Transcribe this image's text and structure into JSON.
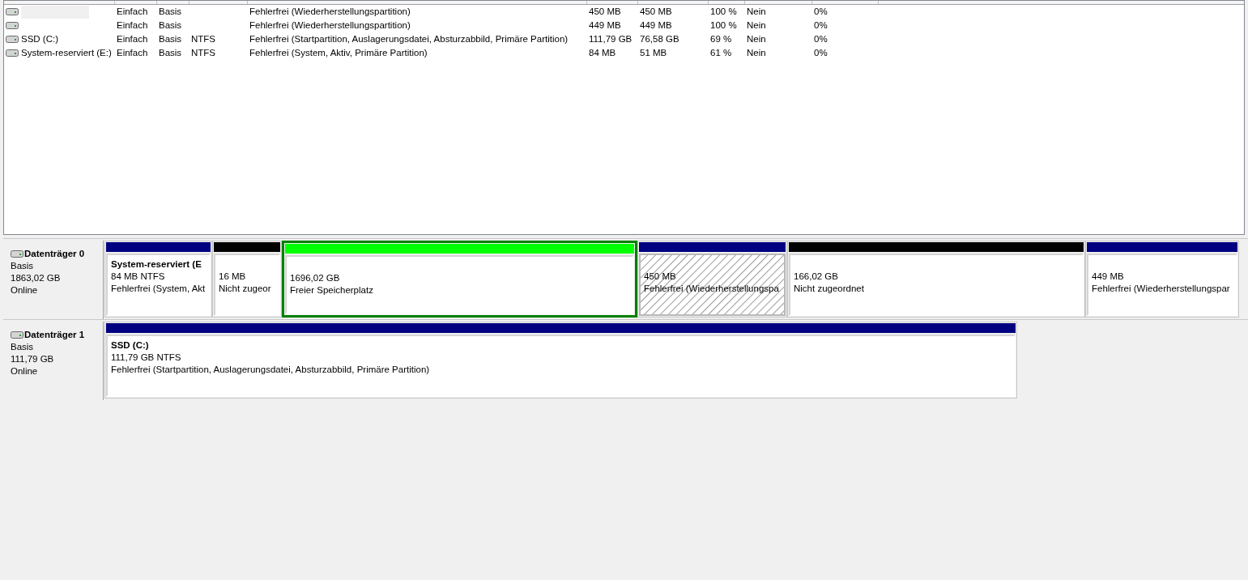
{
  "volumes": [
    {
      "redacted": true,
      "layout": "Einfach",
      "type": "Basis",
      "status": "Fehlerfrei (Wiederherstellungspartition)",
      "capacity": "450 MB",
      "free": "450 MB",
      "free_pct": "100 %",
      "fault_tolerance": "Nein",
      "overhead": "0%"
    },
    {
      "redacted": false,
      "layout": "Einfach",
      "type": "Basis",
      "status": "Fehlerfrei (Wiederherstellungspartition)",
      "capacity": "449 MB",
      "free": "449 MB",
      "free_pct": "100 %",
      "fault_tolerance": "Nein",
      "overhead": "0%"
    },
    {
      "redacted": false,
      "name": "SSD (C:)",
      "layout": "Einfach",
      "type": "Basis",
      "filesystem": "NTFS",
      "status": "Fehlerfrei (Startpartition, Auslagerungsdatei, Absturzabbild, Primäre Partition)",
      "capacity": "111,79 GB",
      "free": "76,58 GB",
      "free_pct": "69 %",
      "fault_tolerance": "Nein",
      "overhead": "0%"
    },
    {
      "redacted": false,
      "name": "System-reserviert (E:)",
      "layout": "Einfach",
      "type": "Basis",
      "filesystem": "NTFS",
      "status": "Fehlerfrei (System, Aktiv, Primäre Partition)",
      "capacity": "84 MB",
      "free": "51 MB",
      "free_pct": "61 %",
      "fault_tolerance": "Nein",
      "overhead": "0%"
    }
  ],
  "disks": [
    {
      "name": "Datenträger 0",
      "type": "Basis",
      "size": "1863,02 GB",
      "state": "Online",
      "partitions": [
        {
          "kind": "primary",
          "color": "#000080",
          "selected": false,
          "title": "System-reserviert  (E",
          "size": "84 MB NTFS",
          "status": "Fehlerfrei (System, Akt"
        },
        {
          "kind": "unallocated",
          "color": "#000000",
          "selected": false,
          "size": "16 MB",
          "status": "Nicht zugeor"
        },
        {
          "kind": "free",
          "color": "#00ff00",
          "selected": false,
          "size": "1696,02 GB",
          "status": "Freier Speicherplatz"
        },
        {
          "kind": "primary",
          "color": "#000080",
          "selected": true,
          "size": "450 MB",
          "status": "Fehlerfrei (Wiederherstellungspa"
        },
        {
          "kind": "unallocated",
          "color": "#000000",
          "selected": false,
          "size": "166,02 GB",
          "status": "Nicht zugeordnet"
        },
        {
          "kind": "primary",
          "color": "#000080",
          "selected": false,
          "size": "449 MB",
          "status": "Fehlerfrei (Wiederherstellungspar"
        }
      ]
    },
    {
      "name": "Datenträger 1",
      "type": "Basis",
      "size": "111,79 GB",
      "state": "Online",
      "partitions": [
        {
          "kind": "primary",
          "color": "#000080",
          "selected": false,
          "title": "SSD  (C:)",
          "size": "111,79 GB NTFS",
          "status": "Fehlerfrei (Startpartition, Auslagerungsdatei, Absturzabbild, Primäre Partition)"
        }
      ]
    }
  ]
}
